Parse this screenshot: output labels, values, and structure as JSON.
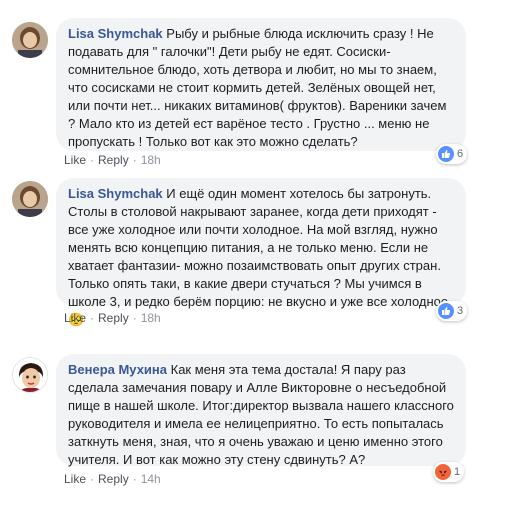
{
  "comments": [
    {
      "author": "Lisa Shymchak",
      "text": "Рыбу и рыбные блюда исключить сразу ! Не подавать для \" галочки\"! Дети рыбу не едят. Сосиски- сомнительное блюдо, хоть детвора и любит, но мы то знаем, что сосисками не стоит кормить детей. Зелёных овощей нет, или почти нет... никаких витаминов( фруктов). Вареники зачем ? Мало кто из детей ест варёное тесто . Грустно ... меню не пропускать ! Только вот как это можно сделать?",
      "like_label": "Like",
      "reply_label": "Reply",
      "sep": "·",
      "time": "18h",
      "reaction": {
        "type": "like",
        "count": "6"
      }
    },
    {
      "author": "Lisa Shymchak",
      "text": "И ещё один момент хотелось бы затронуть. Столы в столовой накрывают заранее, когда дети приходят - все уже холодное или почти холодное. На мой взгляд, нужно менять всю концепцию питания, а не только меню. Если не хватает фантазии- можно позаимствовать опыт других стран. Только опять таки, в какие двери стучаться ? Мы учимся в школе 3, и редко берём порцию: не вкусно и уже все холодное 😔",
      "like_label": "Like",
      "reply_label": "Reply",
      "sep": "·",
      "time": "18h",
      "reaction": {
        "type": "like",
        "count": "3"
      }
    },
    {
      "author": "Венера Мухина",
      "text": "Как меня эта тема достала! Я пару раз сделала замечания повару и Алле Викторовне о несъедобной пище в нашей школе. Итог:директор вызвала нашего классного руководителя и имела ее нелицеприятно. То есть попыталась заткнуть меня, зная, что я очень уважаю и ценю именно этого учителя. И вот как можно эту стену сдвинуть? А?",
      "like_label": "Like",
      "reply_label": "Reply",
      "sep": "·",
      "time": "14h",
      "reaction": {
        "type": "angry",
        "count": "1"
      }
    }
  ],
  "colors": {
    "author": "#385898",
    "bubble": "#f2f3f5",
    "like_reaction": "#5890ff",
    "angry_reaction": "#f0653a"
  }
}
